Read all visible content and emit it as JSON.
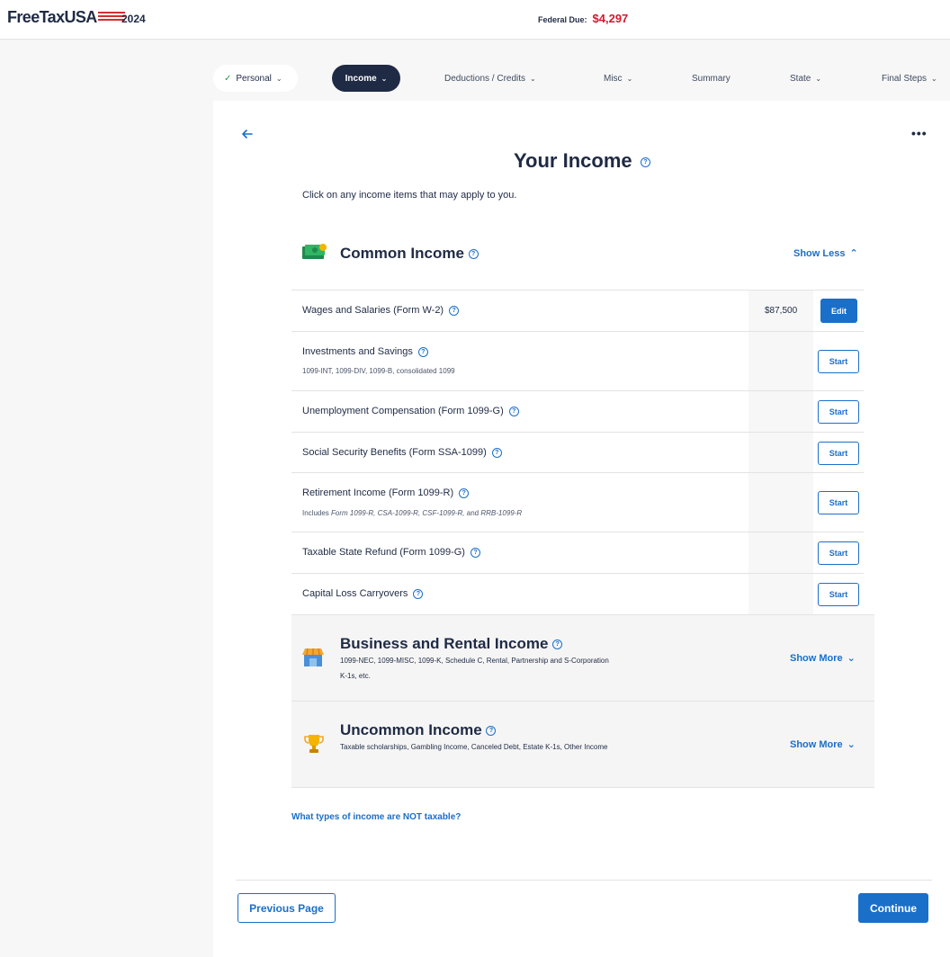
{
  "header": {
    "logo_text": "FreeTaxUSA",
    "year": "2024",
    "federal_due_label": "Federal Due:",
    "federal_due_amount": "$4,297"
  },
  "nav": {
    "personal": "Personal",
    "income": "Income",
    "deductions": "Deductions / Credits",
    "misc": "Misc",
    "summary": "Summary",
    "state": "State",
    "final_steps": "Final Steps"
  },
  "page": {
    "title": "Your Income",
    "subtitle": "Click on any income items that may apply to you."
  },
  "common_income": {
    "title": "Common Income",
    "toggle": "Show Less",
    "rows": [
      {
        "label": "Wages and Salaries (Form W-2)",
        "amount": "$87,500",
        "action": "Edit"
      },
      {
        "label": "Investments and Savings",
        "sub": "1099-INT, 1099-DIV, 1099-B, consolidated 1099",
        "action": "Start"
      },
      {
        "label": "Unemployment Compensation (Form 1099-G)",
        "action": "Start"
      },
      {
        "label": "Social Security Benefits (Form SSA-1099)",
        "action": "Start"
      },
      {
        "label": "Retirement Income (Form 1099-R)",
        "sub_prefix": "Includes",
        "sub_items": "Form 1099-R, CSA-1099-R, CSF-1099-R,",
        "sub_and": "and",
        "sub_last": "RRB-1099-R",
        "action": "Start"
      },
      {
        "label": "Taxable State Refund (Form 1099-G)",
        "action": "Start"
      },
      {
        "label": "Capital Loss Carryovers",
        "action": "Start"
      }
    ]
  },
  "business_income": {
    "title": "Business and Rental Income",
    "desc": "1099-NEC, 1099-MISC, 1099-K, Schedule C, Rental, Partnership and S-Corporation K-1s, etc.",
    "toggle": "Show More"
  },
  "uncommon_income": {
    "title": "Uncommon Income",
    "desc": "Taxable scholarships, Gambling Income, Canceled Debt, Estate K-1s, Other Income",
    "toggle": "Show More"
  },
  "footer": {
    "not_taxable_link": "What types of income are NOT taxable?",
    "previous": "Previous Page",
    "continue": "Continue"
  },
  "colors": {
    "brand_blue": "#1a6fc9",
    "navy": "#1f2a44",
    "due_red": "#d4192c"
  },
  "icons": {
    "back": "arrow-left-icon",
    "more": "more-dots-icon",
    "help": "question-circle-icon",
    "common": "money-icon",
    "business": "storefront-icon",
    "uncommon": "trophy-icon"
  }
}
